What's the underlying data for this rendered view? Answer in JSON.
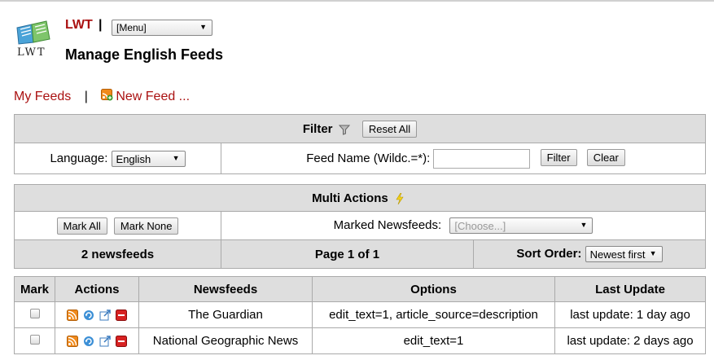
{
  "app": {
    "name": "LWT",
    "separator": "|",
    "logo_text": "LWT",
    "menu_value": "[Menu]",
    "page_title": "Manage English Feeds"
  },
  "nav": {
    "my_feeds": "My Feeds",
    "separator": "|",
    "new_feed": "New Feed ..."
  },
  "filter": {
    "title": "Filter",
    "reset_all": "Reset All",
    "language_label": "Language:",
    "language_value": "English",
    "feed_name_label": "Feed Name (Wildc.=*):",
    "feed_name_value": "",
    "filter_button": "Filter",
    "clear_button": "Clear"
  },
  "multi": {
    "title": "Multi Actions",
    "mark_all": "Mark All",
    "mark_none": "Mark None",
    "marked_label": "Marked Newsfeeds:",
    "marked_value": "[Choose...]",
    "count": "2 newsfeeds",
    "page": "Page 1 of 1",
    "sort_label": "Sort Order:",
    "sort_value": "Newest first"
  },
  "table": {
    "headers": [
      "Mark",
      "Actions",
      "Newsfeeds",
      "Options",
      "Last Update"
    ],
    "rows": [
      {
        "name": "The Guardian",
        "options": "edit_text=1, article_source=description",
        "last_update": "last update: 1 day ago"
      },
      {
        "name": "National Geographic News",
        "options": "edit_text=1",
        "last_update": "last update: 2 days ago"
      }
    ]
  },
  "colors": {
    "link": "#aa1111",
    "header_bg": "#dedede",
    "border": "#aaaaaa"
  }
}
